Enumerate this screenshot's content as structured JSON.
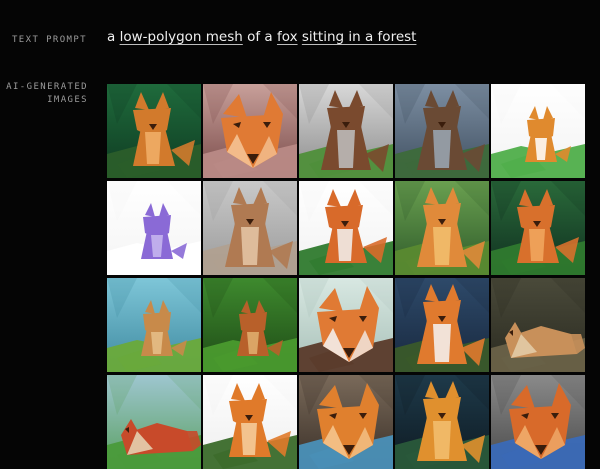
{
  "labels": {
    "text_prompt": "TEXT PROMPT",
    "ai_generated_line1": "AI-GENERATED",
    "ai_generated_line2": "IMAGES"
  },
  "prompt": {
    "part1": "a ",
    "term1": "low-polygon mesh",
    "part2": " of a ",
    "term2": "fox",
    "part3": " ",
    "term3": "sitting in a forest"
  },
  "palette": {
    "fox_orange": "#d9782e",
    "fox_light": "#f0a860",
    "fox_dark": "#8a3d16",
    "forest_green": "#2f7a3a",
    "page_bg": "#050505"
  },
  "grid": {
    "columns": 5,
    "rows": 4,
    "tiles": [
      {
        "bg": [
          "#1f6b3c",
          "#0f3b22"
        ],
        "ground": "#2b5e2a",
        "fox": "#d27a2c",
        "accent": "#f2b06a",
        "variant": "standing"
      },
      {
        "bg": [
          "#c8a09a",
          "#7a4b4a"
        ],
        "ground": "#b98a86",
        "fox": "#e07a34",
        "accent": "#f6c79a",
        "variant": "closeup"
      },
      {
        "bg": [
          "#d8d8d8",
          "#8c8c8c"
        ],
        "ground": "#4f8f3a",
        "fox": "#7a4a2e",
        "accent": "#c0c0c0",
        "variant": "sitting"
      },
      {
        "bg": [
          "#7d8fa3",
          "#3f4f60"
        ],
        "ground": "#3d6a3a",
        "fox": "#6a4a34",
        "accent": "#9aa8b6",
        "variant": "sitting"
      },
      {
        "bg": [
          "#ffffff",
          "#f3f3f3"
        ],
        "ground": "#4fae4a",
        "fox": "#e08a2e",
        "accent": "#ffffff",
        "variant": "small"
      },
      {
        "bg": [
          "#ffffff",
          "#f4f4f4"
        ],
        "ground": "#ffffff",
        "fox": "#8a6ad6",
        "accent": "#c8b8f0",
        "variant": "small"
      },
      {
        "bg": [
          "#c9c9c9",
          "#9a9a9a"
        ],
        "ground": "#b0a090",
        "fox": "#b07a52",
        "accent": "#e6c8a8",
        "variant": "sitting"
      },
      {
        "bg": [
          "#ffffff",
          "#f2f2f2"
        ],
        "ground": "#2f7a2e",
        "fox": "#d86a2a",
        "accent": "#f2f2f2",
        "variant": "standing"
      },
      {
        "bg": [
          "#6aa050",
          "#2e5a2a"
        ],
        "ground": "#5a8a30",
        "fox": "#e08a3a",
        "accent": "#f2c070",
        "variant": "sitting"
      },
      {
        "bg": [
          "#2a6a3a",
          "#103020"
        ],
        "ground": "#2f7a2e",
        "fox": "#d8702c",
        "accent": "#f2a860",
        "variant": "standing"
      },
      {
        "bg": [
          "#7ec6d8",
          "#3f8aa0"
        ],
        "ground": "#6aaa3a",
        "fox": "#c88a4a",
        "accent": "#e6c08a",
        "variant": "small"
      },
      {
        "bg": [
          "#3e8a2e",
          "#1e4a16"
        ],
        "ground": "#4a9a2e",
        "fox": "#b8602a",
        "accent": "#e0b070",
        "variant": "small"
      },
      {
        "bg": [
          "#d8e8e2",
          "#a8c0b8"
        ],
        "ground": "#5a3a2a",
        "fox": "#e07a34",
        "accent": "#f4f4f4",
        "variant": "closeup"
      },
      {
        "bg": [
          "#2e4a6a",
          "#18283e"
        ],
        "ground": "#3a5a2a",
        "fox": "#e07a2e",
        "accent": "#f4f4f4",
        "variant": "sitting"
      },
      {
        "bg": [
          "#4a4a3a",
          "#2a2a20"
        ],
        "ground": "#6a6248",
        "fox": "#c8905a",
        "accent": "#e6d2b0",
        "variant": "lying"
      },
      {
        "bg": [
          "#9ec6d0",
          "#5aa060"
        ],
        "ground": "#4a9a3a",
        "fox": "#c84a2a",
        "accent": "#e8e0c0",
        "variant": "lying"
      },
      {
        "bg": [
          "#ffffff",
          "#eeeeee"
        ],
        "ground": "#3a6a2a",
        "fox": "#e07a2a",
        "accent": "#f6d0a0",
        "variant": "standing"
      },
      {
        "bg": [
          "#7a6a5a",
          "#3a3028"
        ],
        "ground": "#4a90b8",
        "fox": "#e0802e",
        "accent": "#f6c890",
        "variant": "closeup"
      },
      {
        "bg": [
          "#1e3a4a",
          "#0e1a22"
        ],
        "ground": "#2a5a3a",
        "fox": "#e0902e",
        "accent": "#f2c070",
        "variant": "sitting"
      },
      {
        "bg": [
          "#8a8a8a",
          "#4a4a4a"
        ],
        "ground": "#3a6ab8",
        "fox": "#d86a2a",
        "accent": "#f2b070",
        "variant": "closeup"
      }
    ]
  }
}
